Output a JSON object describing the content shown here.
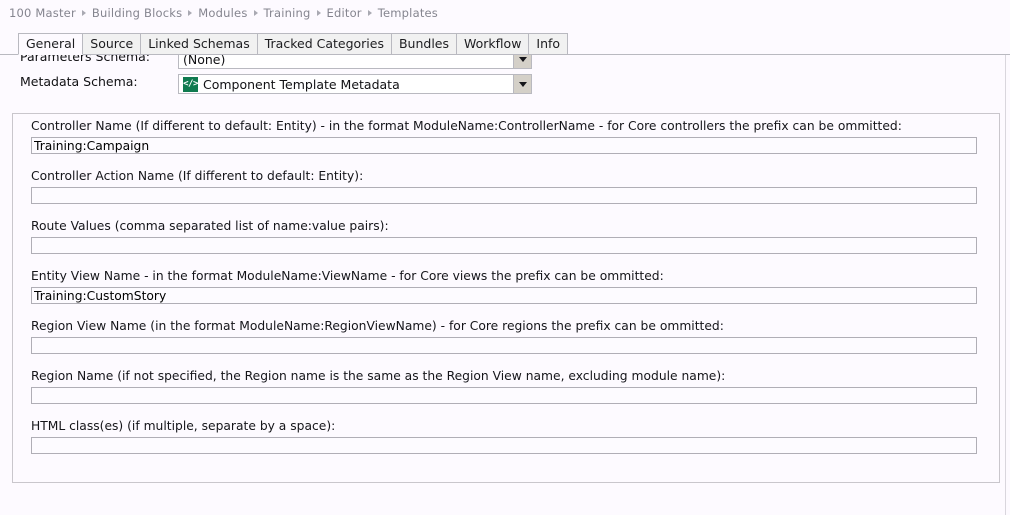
{
  "breadcrumb": {
    "items": [
      {
        "label": "100 Master"
      },
      {
        "label": "Building Blocks"
      },
      {
        "label": "Modules"
      },
      {
        "label": "Training"
      },
      {
        "label": "Editor"
      },
      {
        "label": "Templates"
      }
    ]
  },
  "tabs": [
    {
      "label": "General",
      "active": true
    },
    {
      "label": "Source",
      "active": false
    },
    {
      "label": "Linked Schemas",
      "active": false
    },
    {
      "label": "Tracked Categories",
      "active": false
    },
    {
      "label": "Bundles",
      "active": false
    },
    {
      "label": "Workflow",
      "active": false
    },
    {
      "label": "Info",
      "active": false
    }
  ],
  "schema_rows": [
    {
      "label": "Parameters Schema:",
      "value": "(None)",
      "icon": null
    },
    {
      "label": "Metadata Schema:",
      "value": "Component Template Metadata",
      "icon": "code-schema-icon",
      "icon_glyph": "</>",
      "icon_color": "#0f7a4f"
    }
  ],
  "fields": [
    {
      "label": "Controller Name (If different to default: Entity) - in the format ModuleName:ControllerName - for Core controllers the prefix can be ommitted:",
      "value": "Training:Campaign",
      "placeholder": ""
    },
    {
      "label": "Controller Action Name (If different to default: Entity):",
      "value": "",
      "placeholder": ""
    },
    {
      "label": "Route Values (comma separated list of name:value pairs):",
      "value": "",
      "placeholder": ""
    },
    {
      "label": "Entity View Name - in the format ModuleName:ViewName - for Core views the prefix can be ommitted:",
      "value": "Training:CustomStory",
      "placeholder": ""
    },
    {
      "label": "Region View Name (in the format ModuleName:RegionViewName) - for Core regions the prefix can be ommitted:",
      "value": "",
      "placeholder": ""
    },
    {
      "label": "Region Name (if not specified, the Region name is the same as the Region View name, excluding module name):",
      "value": "",
      "placeholder": ""
    },
    {
      "label": "HTML class(es) (if multiple, separate by a space):",
      "value": "",
      "placeholder": ""
    }
  ]
}
